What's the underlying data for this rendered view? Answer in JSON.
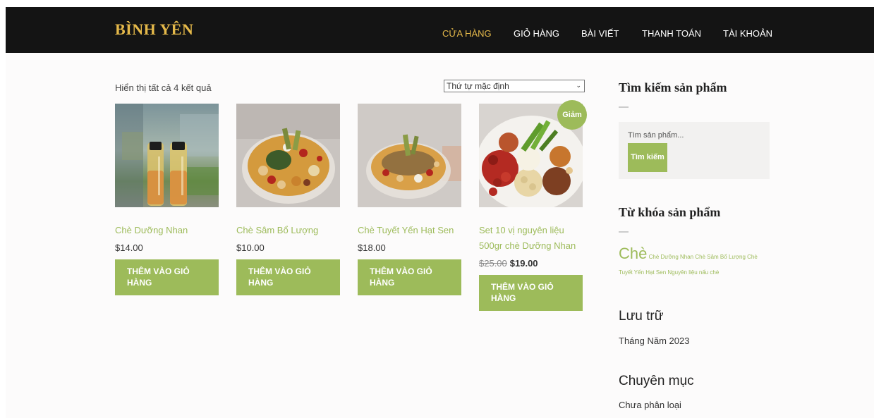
{
  "header": {
    "logo": "BÌNH YÊN",
    "nav": [
      "CỬA HÀNG",
      "GIỎ HÀNG",
      "BÀI VIẾT",
      "THANH TOÁN",
      "TÀI KHOẢN"
    ],
    "active_nav": "CỬA HÀNG"
  },
  "shop": {
    "result_count": "Hiển thị tất cả 4 kết quả",
    "orderby": "Thứ tự mặc định",
    "products": [
      {
        "name": "Chè Dưỡng Nhan",
        "price": "$14.00",
        "button": "THÊM VÀO GIỎ HÀNG"
      },
      {
        "name": "Chè Sâm Bổ Lượng",
        "price": "$10.00",
        "button": "THÊM VÀO GIỎ HÀNG"
      },
      {
        "name": "Chè Tuyết Yến Hạt Sen",
        "price": "$18.00",
        "button": "THÊM VÀO GIỎ HÀNG"
      },
      {
        "name": "Set 10 vị nguyên liệu 500gr chè Dưỡng Nhan",
        "old_price": "$25.00",
        "price": "$19.00",
        "badge": "Giảm",
        "button": "THÊM VÀO GIỎ HÀNG"
      }
    ]
  },
  "sidebar": {
    "search": {
      "title": "Tìm kiếm sản phẩm",
      "placeholder": "Tìm sản phẩm...",
      "button": "Tìm kiếm"
    },
    "tags": {
      "title": "Từ khóa sản phẩm",
      "items": [
        "Chè",
        "Chè Dưỡng Nhan",
        "Chè Sâm Bổ Lượng",
        "Chè Tuyết Yến Hạt Sen",
        "Nguyên liệu nấu chè"
      ]
    },
    "archives": {
      "title": "Lưu trữ",
      "items": [
        "Tháng Năm 2023"
      ]
    },
    "categories": {
      "title": "Chuyên mục",
      "items": [
        "Chưa phân loại"
      ]
    }
  },
  "colors": {
    "accent": "#9dbb5a",
    "brand": "#e5b94a",
    "header_bg": "#141414"
  }
}
